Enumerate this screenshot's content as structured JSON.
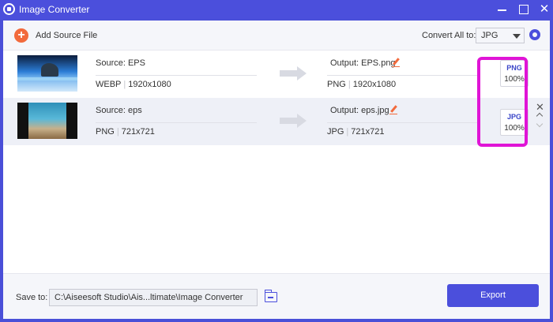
{
  "window": {
    "title": "Image Converter",
    "close_glyph": "✕",
    "colors": {
      "accent": "#4b4fdc",
      "add": "#f26a3c",
      "highlight": "#e014d6"
    }
  },
  "toolbar": {
    "add_label": "Add Source File",
    "add_glyph": "+",
    "convert_all_label": "Convert All to:",
    "convert_all_value": "JPG",
    "settings_icon": "gear-icon"
  },
  "files": [
    {
      "source_label": "Source: EPS",
      "source_format": "WEBP",
      "source_dims": "1920x1080",
      "output_label": "Output: EPS.png",
      "output_format": "PNG",
      "output_dims": "1920x1080",
      "format_badge": "PNG",
      "quality": "100%"
    },
    {
      "source_label": "Source: eps",
      "source_format": "PNG",
      "source_dims": "721x721",
      "output_label": "Output: eps.jpg",
      "output_format": "JPG",
      "output_dims": "721x721",
      "format_badge": "JPG",
      "quality": "100%"
    }
  ],
  "row_close_glyph": "✕",
  "separator": "|",
  "footer": {
    "save_label": "Save to:",
    "save_path": "C:\\Aiseesoft Studio\\Ais...ltimate\\Image Converter",
    "export_label": "Export"
  }
}
